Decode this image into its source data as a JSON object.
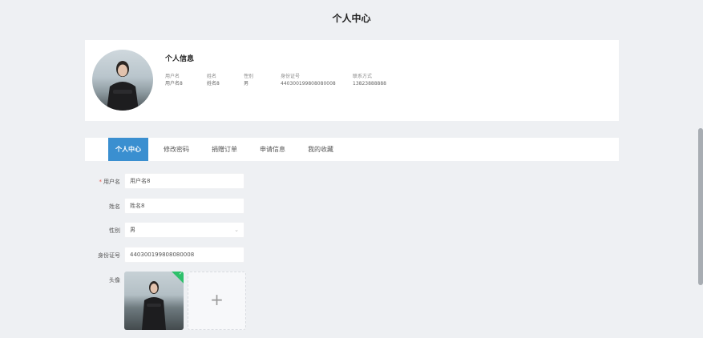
{
  "page": {
    "title": "个人中心"
  },
  "profile": {
    "title": "个人信息",
    "fields": [
      {
        "label": "用户名",
        "value": "用户名8"
      },
      {
        "label": "姓名",
        "value": "姓名8"
      },
      {
        "label": "性别",
        "value": "男"
      },
      {
        "label": "身份证号",
        "value": "440300199808080008"
      },
      {
        "label": "联系方式",
        "value": "13823888888"
      }
    ]
  },
  "tabs": [
    {
      "label": "个人中心",
      "active": true
    },
    {
      "label": "修改密码"
    },
    {
      "label": "捐赠订单"
    },
    {
      "label": "申请信息"
    },
    {
      "label": "我的收藏"
    }
  ],
  "form": {
    "username": {
      "label": "用户名",
      "required": "*",
      "value": "用户名8"
    },
    "name": {
      "label": "姓名",
      "value": "姓名8"
    },
    "gender": {
      "label": "性别",
      "value": "男"
    },
    "idcard": {
      "label": "身份证号",
      "value": "440300199808080008"
    },
    "avatar": {
      "label": "头像",
      "upload_symbol": "+"
    }
  },
  "colors": {
    "accent": "#3a8fd0",
    "success": "#2ec06b",
    "required": "#e8534a"
  }
}
